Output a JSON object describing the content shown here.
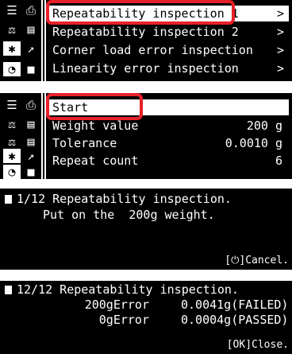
{
  "menu1": {
    "items": [
      {
        "label": "Repeatability inspection 1",
        "chevron": ">"
      },
      {
        "label": "Repeatability inspection 2",
        "chevron": ">"
      },
      {
        "label": "Corner load error inspection",
        "chevron": ">"
      },
      {
        "label": "Linearity error inspection",
        "chevron": ">"
      }
    ]
  },
  "menu2": {
    "start_label": "Start",
    "rows": [
      {
        "label": "Weight value",
        "value": "200 g"
      },
      {
        "label": "Tolerance",
        "value": "0.0010 g"
      },
      {
        "label": "Repeat count",
        "value": "6"
      }
    ]
  },
  "dialog1": {
    "line1": "1/12 Repeatability inspection.",
    "line2": "Put on the  200g weight.",
    "cancel": "[⏻]Cancel."
  },
  "dialog2": {
    "line1": "12/12 Repeatability inspection.",
    "r1_label": "200gError",
    "r1_value": "0.0041g(FAILED)",
    "r2_label": "0gError",
    "r2_value": "0.0004g(PASSED)",
    "close": "[OK]Close."
  },
  "colors": {
    "highlight": "#e8202a",
    "screen": "#000000",
    "text": "#ffffff"
  },
  "icons": [
    "list-icon",
    "print-icon",
    "balance-icon",
    "settings-icon",
    "calibration-icon",
    "save-icon",
    "gear-icon",
    "graph-icon",
    "user-icon",
    "screen-icon"
  ]
}
